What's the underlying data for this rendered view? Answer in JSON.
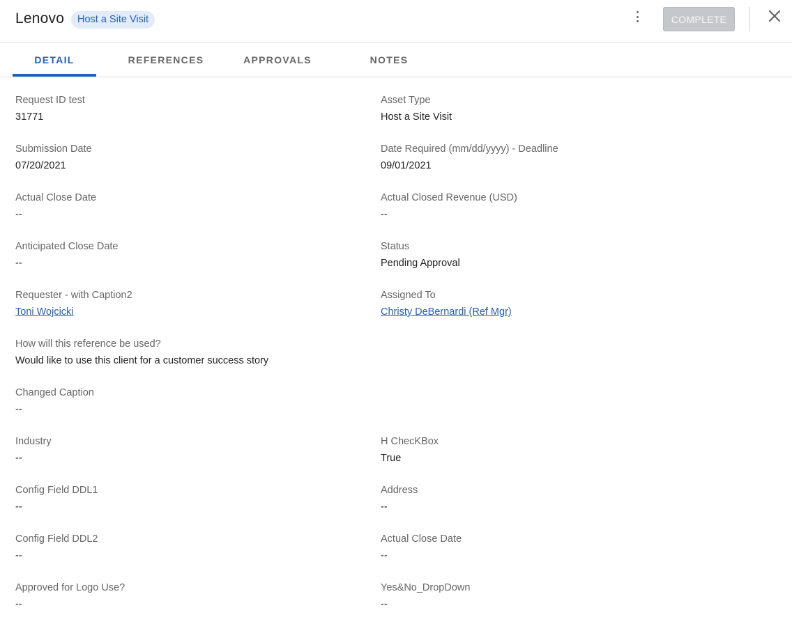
{
  "header": {
    "title": "Lenovo",
    "chip": "Host a Site Visit",
    "complete_label": "COMPLETE"
  },
  "tabs": [
    {
      "label": "DETAIL",
      "active": true
    },
    {
      "label": "REFERENCES",
      "active": false
    },
    {
      "label": "APPROVALS",
      "active": false
    },
    {
      "label": "NOTES",
      "active": false
    }
  ],
  "fields": {
    "request_id": {
      "label": "Request ID test",
      "value": "31771"
    },
    "asset_type": {
      "label": "Asset Type",
      "value": "Host a Site Visit"
    },
    "submission_date": {
      "label": "Submission Date",
      "value": "07/20/2021"
    },
    "date_required": {
      "label": "Date Required (mm/dd/yyyy) - Deadline",
      "value": "09/01/2021"
    },
    "actual_close_date": {
      "label": "Actual Close Date",
      "value": "--"
    },
    "actual_closed_revenue": {
      "label": "Actual Closed Revenue (USD)",
      "value": "--"
    },
    "anticipated_close_date": {
      "label": "Anticipated Close Date",
      "value": "--"
    },
    "status": {
      "label": "Status",
      "value": "Pending Approval"
    },
    "requester": {
      "label": "Requester - with Caption2",
      "value": "Toni Wojcicki"
    },
    "assigned_to": {
      "label": "Assigned To",
      "value": "Christy DeBernardi (Ref Mgr)"
    },
    "reference_usage": {
      "label": "How will this reference be used?",
      "value": "Would like to use this client for a customer success story"
    },
    "changed_caption": {
      "label": "Changed Caption",
      "value": "--"
    },
    "industry": {
      "label": "Industry",
      "value": "--"
    },
    "h_checkbox": {
      "label": "H ChecKBox",
      "value": "True"
    },
    "config_ddl1": {
      "label": "Config Field DDL1",
      "value": "--"
    },
    "address": {
      "label": "Address",
      "value": "--"
    },
    "config_ddl2": {
      "label": "Config Field DDL2",
      "value": "--"
    },
    "actual_close_date_2": {
      "label": "Actual Close Date",
      "value": "--"
    },
    "approved_logo": {
      "label": "Approved for Logo Use?",
      "value": "--"
    },
    "yes_no_dropdown": {
      "label": "Yes&No_DropDown",
      "value": "--"
    }
  },
  "colors": {
    "accent": "#2560b0",
    "chip_bg": "#e2ecf9",
    "disabled_button": "#c4c7cc"
  },
  "icons": {
    "menu": "kebab-menu-icon",
    "close": "close-icon"
  }
}
